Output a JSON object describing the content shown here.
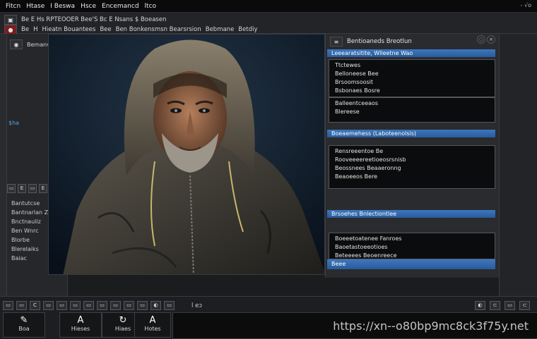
{
  "menubar": {
    "items": [
      "Fitcn",
      "Htase",
      "I Beswa",
      "Hsce",
      "Encemancd",
      "ltco"
    ],
    "right_text": "- √o"
  },
  "toolbar": {
    "row1_text": "Be E Hs RPTEOOER Bee'S Bc  E  Nsans  $  Boeasen",
    "row2_items": [
      "Be",
      "H",
      "Hieatn Bouantees",
      "Bee",
      "Ben Bonkensmsn Bearsrsion",
      "Bebmane",
      "Betdiy"
    ]
  },
  "sidepanel": {
    "head_label": "Bemanvate",
    "mark": "$ha",
    "tool_glyphs": [
      "▭",
      "E",
      "▭",
      "E",
      "▭"
    ],
    "list": [
      "Bantutcse",
      "Bantnarlan Z",
      "Bnctnauliz",
      "Ben Wnrc",
      "Blorbe",
      "Blerelaiks",
      "Baiac"
    ]
  },
  "rightpanel": {
    "title": "Bentioaneds Breotlun",
    "section1": {
      "bar": "Leeearatsitite, Wlleetne Wao",
      "lines": [
        "Ttctewes",
        "Belloneese Bee",
        "Brsoomsoosit",
        "Bsbonaes Bosre",
        "Balleentceeaos",
        "Blereese"
      ]
    },
    "section2": {
      "bar": "Boeaemehess (Laboteenolsis)",
      "lines": [
        "Rensreeentoe Be",
        "Rooveeeereetioeosrsnisb",
        "Beossnees Beaaeronng",
        "Beaoeeos Bere"
      ]
    },
    "section3": {
      "bar": "Brsoehes Bnlectiontlee",
      "lines": [
        "Boeeetoatenee Fanroes",
        "Baoetastoeeotioes",
        "Beteeees Beoenreece"
      ]
    },
    "footer_bar": "Beee"
  },
  "bottombar": {
    "tools": [
      "▭",
      "▭",
      "C",
      "▭",
      "▭",
      "▭",
      "▭",
      "▭",
      "▭",
      "▭",
      "▭",
      "◐",
      "▭"
    ],
    "label": "l eɔ",
    "thumbs": [
      {
        "icon": "✎",
        "label": "Boa"
      },
      {
        "icon": "A",
        "label": "Hieses"
      },
      {
        "icon": "↻",
        "label": "Hiaes"
      },
      {
        "icon": "A",
        "label": "Hotes"
      }
    ],
    "right_glyphs": [
      "◐",
      "⊂",
      "▭",
      "⊂"
    ]
  },
  "watermark": "https://xn--o80bp9mc8ck3f75y.net",
  "colors": {
    "accent": "#3c77c0",
    "background": "#1b1c1e",
    "panel": "#2a2b2e"
  }
}
